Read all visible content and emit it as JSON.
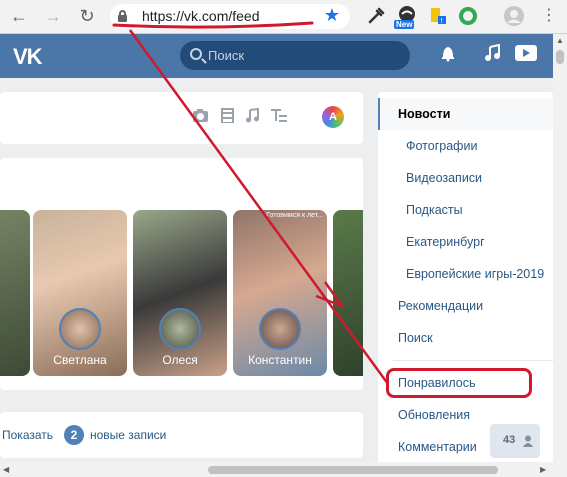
{
  "browser": {
    "url": "https://vk.com/feed",
    "new_badge": "New",
    "back_icon": "arrow-left-icon",
    "forward_icon": "arrow-right-icon",
    "reload_icon": "reload-icon"
  },
  "header": {
    "logo": "VK",
    "search_placeholder": "Поиск"
  },
  "composer": {
    "avatar_letter": "A"
  },
  "stories": [
    {
      "name": ""
    },
    {
      "name": "Светлана"
    },
    {
      "name": "Олеся"
    },
    {
      "name": "Константин",
      "caption": "Готовимся к лет..."
    },
    {
      "name": ""
    }
  ],
  "new_posts": {
    "prefix": "Показать",
    "count": "2",
    "suffix": "новые записи"
  },
  "menu": {
    "items": [
      {
        "label": "Новости"
      },
      {
        "label": "Фотографии"
      },
      {
        "label": "Видеозаписи"
      },
      {
        "label": "Подкасты"
      },
      {
        "label": "Екатеринбург"
      },
      {
        "label": "Европейские игры-2019"
      },
      {
        "label": "Рекомендации"
      },
      {
        "label": "Поиск"
      },
      {
        "label": "Понравилось"
      },
      {
        "label": "Обновления"
      },
      {
        "label": "Комментарии"
      }
    ]
  },
  "online_count": "43",
  "colors": {
    "vk_blue": "#4a76a8",
    "annotation_red": "#d0192c"
  }
}
